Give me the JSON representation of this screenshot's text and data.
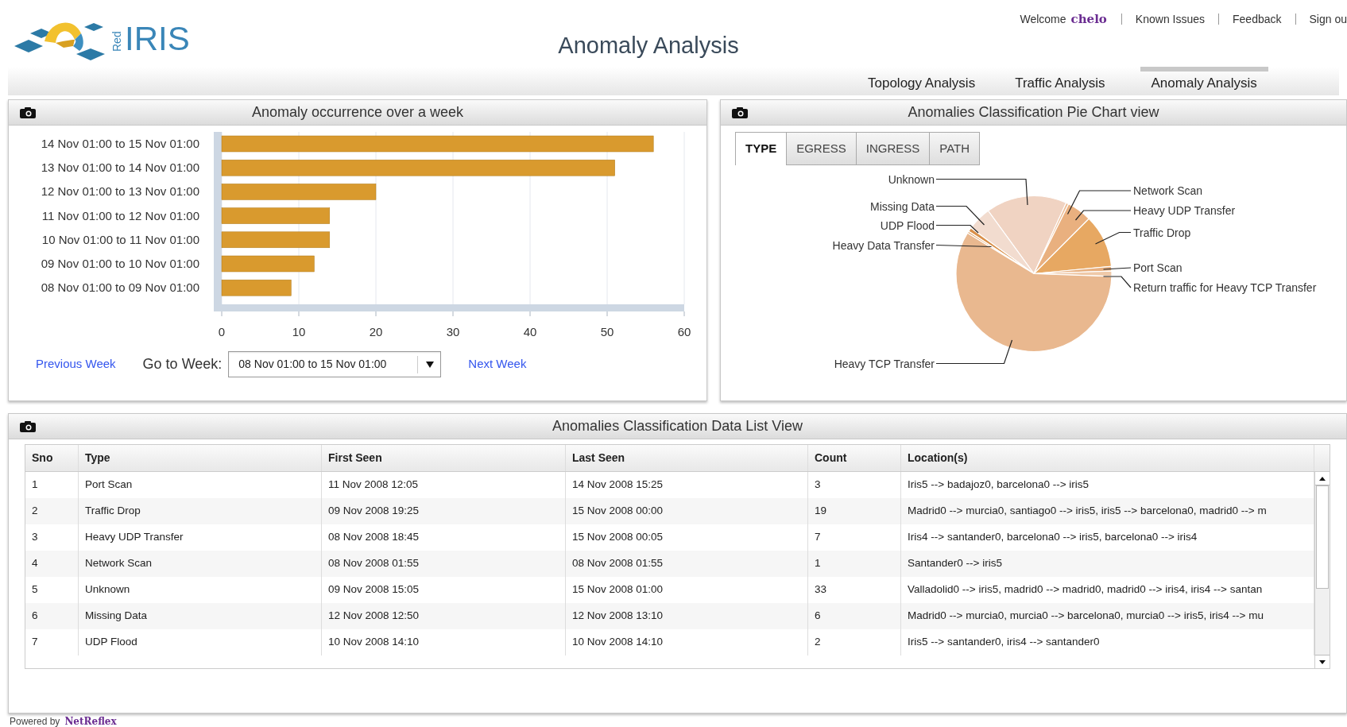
{
  "logo": {
    "subtext": "Red",
    "text": "IRIS"
  },
  "header": {
    "title": "Anomaly Analysis",
    "welcome": "Welcome",
    "user": "chelo",
    "links": [
      "Known Issues",
      "Feedback",
      "Sign ou"
    ]
  },
  "nav": [
    {
      "label": "Topology Analysis",
      "selected": false
    },
    {
      "label": "Traffic Analysis",
      "selected": false
    },
    {
      "label": "Anomaly Analysis",
      "selected": true
    }
  ],
  "bar_panel": {
    "title": "Anomaly occurrence over a week",
    "chart_data": {
      "type": "bar",
      "orientation": "horizontal",
      "categories": [
        "14 Nov 01:00 to 15 Nov 01:00",
        "13 Nov 01:00 to 14 Nov 01:00",
        "12 Nov 01:00 to 13 Nov 01:00",
        "11 Nov 01:00 to 12 Nov 01:00",
        "10 Nov 01:00 to 11 Nov 01:00",
        "09 Nov 01:00 to 10 Nov 01:00",
        "08 Nov 01:00 to 09 Nov 01:00"
      ],
      "values": [
        56,
        51,
        20,
        14,
        14,
        12,
        9
      ],
      "grid": true,
      "xlim": [
        0,
        60
      ],
      "xticks": [
        0,
        10,
        20,
        30,
        40,
        50,
        60
      ]
    },
    "previous": "Previous Week",
    "goto_label": "Go to Week:",
    "week_select": "08 Nov 01:00 to 15 Nov 01:00",
    "next": "Next Week"
  },
  "pie_panel": {
    "title": "Anomalies Classification Pie Chart view",
    "tabs": [
      {
        "label": "TYPE",
        "selected": true
      },
      {
        "label": "EGRESS",
        "selected": false
      },
      {
        "label": "INGRESS",
        "selected": false
      },
      {
        "label": "PATH",
        "selected": false
      }
    ],
    "labels": [
      "Unknown",
      "Network Scan",
      "Missing Data",
      "Heavy UDP Transfer",
      "UDP Flood",
      "Traffic Drop",
      "Heavy Data Transfer",
      "Port Scan",
      "Return traffic for Heavy TCP Transfer",
      "Heavy TCP Transfer"
    ]
  },
  "table_panel": {
    "title": "Anomalies Classification Data List View",
    "columns": [
      "Sno",
      "Type",
      "First Seen",
      "Last Seen",
      "Count",
      "Location(s)"
    ],
    "rows": [
      [
        "1",
        "Port Scan",
        "11 Nov 2008 12:05",
        "14 Nov 2008 15:25",
        "3",
        "Iris5 --> badajoz0, barcelona0 --> iris5"
      ],
      [
        "2",
        "Traffic Drop",
        "09 Nov 2008 19:25",
        "15 Nov 2008 00:00",
        "19",
        "Madrid0 --> murcia0, santiago0 --> iris5, iris5 --> barcelona0, madrid0 --> m"
      ],
      [
        "3",
        "Heavy UDP Transfer",
        "08 Nov 2008 18:45",
        "15 Nov 2008 00:05",
        "7",
        "Iris4 --> santander0, barcelona0 --> iris5, barcelona0 --> iris4"
      ],
      [
        "4",
        "Network Scan",
        "08 Nov 2008 01:55",
        "08 Nov 2008 01:55",
        "1",
        "Santander0 --> iris5"
      ],
      [
        "5",
        "Unknown",
        "09 Nov 2008 15:05",
        "15 Nov 2008 01:00",
        "33",
        "Valladolid0 --> iris5, madrid0 --> madrid0, madrid0 --> iris4, iris4 --> santan"
      ],
      [
        "6",
        "Missing Data",
        "12 Nov 2008 12:50",
        "12 Nov 2008 13:10",
        "6",
        "Madrid0 --> murcia0, murcia0 --> barcelona0, murcia0 --> iris5, iris4 --> mu"
      ],
      [
        "7",
        "UDP Flood",
        "10 Nov 2008 14:10",
        "10 Nov 2008 14:10",
        "2",
        "Iris5 --> santander0, iris4 --> santander0"
      ]
    ]
  },
  "footer": {
    "text": "Powered by",
    "brand": "NetReflex"
  }
}
